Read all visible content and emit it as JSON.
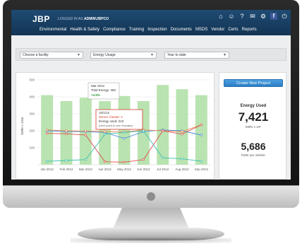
{
  "header": {
    "brand": "JBP",
    "logged_prefix": "LOGGED IN AS",
    "logged_user": "ADMIN\\JBPCO",
    "icons": [
      "home-icon",
      "user-icon",
      "help-icon",
      "mail-icon",
      "gear-icon",
      "facebook-icon",
      "power-icon"
    ]
  },
  "nav": {
    "items": [
      "Environmental",
      "Health & Safety",
      "Compliance",
      "Training",
      "Inspection",
      "Documents",
      "MSDS",
      "Vendor",
      "Certs",
      "Reports"
    ]
  },
  "filters": {
    "facility": "Choose a facility",
    "metric": "Energy Usage",
    "period": "Year to date"
  },
  "sidebar": {
    "button": "Create New Project",
    "metric_label": "Energy Used",
    "metric_value": "7,421",
    "metric_unit": "kWhr x 10⁶",
    "secondary_value": "5,686",
    "secondary_unit": "kWhr per vehicle"
  },
  "tooltip_total": {
    "month": "Mar 2012",
    "line": "Total Energy: 360",
    "change": "+4.5%"
  },
  "tooltip_cluster": {
    "date": "10/1/12",
    "title": "Server Cluster: A",
    "line": "Energy used: 210",
    "hint": "(click point to see changes)"
  },
  "colors": {
    "header_dark": "#123453",
    "bar": "#b9e3b0",
    "line_orange": "#e8885a",
    "line_red": "#e05050",
    "line_blue": "#4a90d8",
    "line_teal": "#3cc0b0",
    "button_blue": "#2b7fc4",
    "tooltip_red": "#d33a2a"
  },
  "chart_data": {
    "type": "bar",
    "ylabel": "kWhr x 10x6",
    "ylim": [
      0,
      500
    ],
    "yticks": [
      "100",
      "200",
      "300",
      "400",
      "500"
    ],
    "categories": [
      "Jan 2012",
      "Feb 2012",
      "Mar 2012",
      "Apr 2012",
      "May 2012",
      "Jun 2012",
      "Jul 2012",
      "Aug 2012",
      "Sep 2012"
    ],
    "values": [
      410,
      375,
      395,
      375,
      405,
      375,
      470,
      445,
      410
    ],
    "series": [
      {
        "values": [
          200,
          195,
          195,
          190,
          155,
          195,
          205,
          200,
          175
        ]
      },
      {
        "values": [
          205,
          200,
          198,
          195,
          192,
          205,
          200,
          195,
          235
        ]
      },
      {
        "values": [
          185,
          182,
          175,
          18,
          15,
          30,
          200,
          180,
          235
        ]
      },
      {
        "values": [
          20,
          25,
          30,
          180,
          190,
          200,
          40,
          35,
          20
        ]
      }
    ]
  }
}
